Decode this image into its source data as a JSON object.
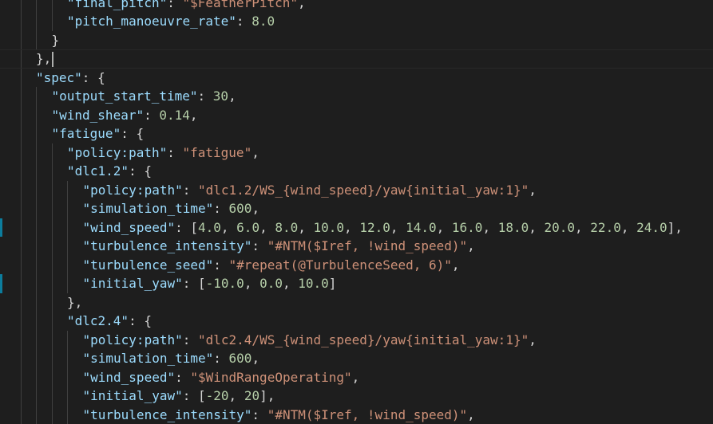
{
  "colors": {
    "background": "#1e1e1e",
    "key": "#9cdcfe",
    "string": "#ce9178",
    "number": "#b5cea8",
    "punctuation": "#d4d4d4",
    "gutter_change": "#0c7d9d"
  },
  "editor": {
    "lines": [
      {
        "indent": 4,
        "parts": [
          [
            "k",
            "\"final_pitch\""
          ],
          [
            "p",
            ": "
          ],
          [
            "s",
            "\"$FeatherPitch\""
          ],
          [
            "p",
            ","
          ]
        ]
      },
      {
        "indent": 4,
        "parts": [
          [
            "k",
            "\"pitch_manoeuvre_rate\""
          ],
          [
            "p",
            ": "
          ],
          [
            "n",
            "8.0"
          ]
        ]
      },
      {
        "indent": 3,
        "parts": [
          [
            "p",
            "}"
          ]
        ]
      },
      {
        "indent": 2,
        "current": true,
        "cursor": true,
        "parts": [
          [
            "p",
            "},"
          ]
        ]
      },
      {
        "indent": 2,
        "parts": [
          [
            "k",
            "\"spec\""
          ],
          [
            "p",
            ": {"
          ]
        ]
      },
      {
        "indent": 3,
        "parts": [
          [
            "k",
            "\"output_start_time\""
          ],
          [
            "p",
            ": "
          ],
          [
            "n",
            "30"
          ],
          [
            "p",
            ","
          ]
        ]
      },
      {
        "indent": 3,
        "parts": [
          [
            "k",
            "\"wind_shear\""
          ],
          [
            "p",
            ": "
          ],
          [
            "n",
            "0.14"
          ],
          [
            "p",
            ","
          ]
        ]
      },
      {
        "indent": 3,
        "parts": [
          [
            "k",
            "\"fatigue\""
          ],
          [
            "p",
            ": {"
          ]
        ]
      },
      {
        "indent": 4,
        "parts": [
          [
            "k",
            "\"policy:path\""
          ],
          [
            "p",
            ": "
          ],
          [
            "s",
            "\"fatigue\""
          ],
          [
            "p",
            ","
          ]
        ]
      },
      {
        "indent": 4,
        "parts": [
          [
            "k",
            "\"dlc1.2\""
          ],
          [
            "p",
            ": {"
          ]
        ]
      },
      {
        "indent": 5,
        "parts": [
          [
            "k",
            "\"policy:path\""
          ],
          [
            "p",
            ": "
          ],
          [
            "s",
            "\"dlc1.2/WS_{wind_speed}/yaw{initial_yaw:1}\""
          ],
          [
            "p",
            ","
          ]
        ]
      },
      {
        "indent": 5,
        "parts": [
          [
            "k",
            "\"simulation_time\""
          ],
          [
            "p",
            ": "
          ],
          [
            "n",
            "600"
          ],
          [
            "p",
            ","
          ]
        ]
      },
      {
        "indent": 5,
        "gutter": true,
        "parts": [
          [
            "k",
            "\"wind_speed\""
          ],
          [
            "p",
            ": ["
          ],
          [
            "n",
            "4.0"
          ],
          [
            "p",
            ", "
          ],
          [
            "n",
            "6.0"
          ],
          [
            "p",
            ", "
          ],
          [
            "n",
            "8.0"
          ],
          [
            "p",
            ", "
          ],
          [
            "n",
            "10.0"
          ],
          [
            "p",
            ", "
          ],
          [
            "n",
            "12.0"
          ],
          [
            "p",
            ", "
          ],
          [
            "n",
            "14.0"
          ],
          [
            "p",
            ", "
          ],
          [
            "n",
            "16.0"
          ],
          [
            "p",
            ", "
          ],
          [
            "n",
            "18.0"
          ],
          [
            "p",
            ", "
          ],
          [
            "n",
            "20.0"
          ],
          [
            "p",
            ", "
          ],
          [
            "n",
            "22.0"
          ],
          [
            "p",
            ", "
          ],
          [
            "n",
            "24.0"
          ],
          [
            "p",
            "],"
          ]
        ]
      },
      {
        "indent": 5,
        "parts": [
          [
            "k",
            "\"turbulence_intensity\""
          ],
          [
            "p",
            ": "
          ],
          [
            "s",
            "\"#NTM($Iref, !wind_speed)\""
          ],
          [
            "p",
            ","
          ]
        ]
      },
      {
        "indent": 5,
        "parts": [
          [
            "k",
            "\"turbulence_seed\""
          ],
          [
            "p",
            ": "
          ],
          [
            "s",
            "\"#repeat(@TurbulenceSeed, 6)\""
          ],
          [
            "p",
            ","
          ]
        ]
      },
      {
        "indent": 5,
        "gutter": true,
        "parts": [
          [
            "k",
            "\"initial_yaw\""
          ],
          [
            "p",
            ": ["
          ],
          [
            "n",
            "-10.0"
          ],
          [
            "p",
            ", "
          ],
          [
            "n",
            "0.0"
          ],
          [
            "p",
            ", "
          ],
          [
            "n",
            "10.0"
          ],
          [
            "p",
            "]"
          ]
        ]
      },
      {
        "indent": 4,
        "parts": [
          [
            "p",
            "},"
          ]
        ]
      },
      {
        "indent": 4,
        "parts": [
          [
            "k",
            "\"dlc2.4\""
          ],
          [
            "p",
            ": {"
          ]
        ]
      },
      {
        "indent": 5,
        "parts": [
          [
            "k",
            "\"policy:path\""
          ],
          [
            "p",
            ": "
          ],
          [
            "s",
            "\"dlc2.4/WS_{wind_speed}/yaw{initial_yaw:1}\""
          ],
          [
            "p",
            ","
          ]
        ]
      },
      {
        "indent": 5,
        "parts": [
          [
            "k",
            "\"simulation_time\""
          ],
          [
            "p",
            ": "
          ],
          [
            "n",
            "600"
          ],
          [
            "p",
            ","
          ]
        ]
      },
      {
        "indent": 5,
        "parts": [
          [
            "k",
            "\"wind_speed\""
          ],
          [
            "p",
            ": "
          ],
          [
            "s",
            "\"$WindRangeOperating\""
          ],
          [
            "p",
            ","
          ]
        ]
      },
      {
        "indent": 5,
        "parts": [
          [
            "k",
            "\"initial_yaw\""
          ],
          [
            "p",
            ": ["
          ],
          [
            "n",
            "-20"
          ],
          [
            "p",
            ", "
          ],
          [
            "n",
            "20"
          ],
          [
            "p",
            "],"
          ]
        ]
      },
      {
        "indent": 5,
        "parts": [
          [
            "k",
            "\"turbulence_intensity\""
          ],
          [
            "p",
            ": "
          ],
          [
            "s",
            "\"#NTM($Iref, !wind_speed)\""
          ],
          [
            "p",
            ","
          ]
        ]
      }
    ]
  }
}
